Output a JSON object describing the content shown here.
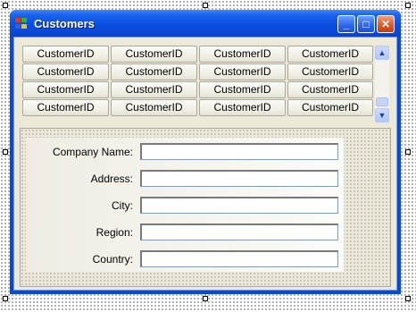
{
  "window": {
    "title": "Customers"
  },
  "title_buttons": {
    "minimize": "_",
    "maximize": "□",
    "close": "✕"
  },
  "grid": {
    "rows": [
      [
        "CustomerID",
        "CustomerID",
        "CustomerID",
        "CustomerID"
      ],
      [
        "CustomerID",
        "CustomerID",
        "CustomerID",
        "CustomerID"
      ],
      [
        "CustomerID",
        "CustomerID",
        "CustomerID",
        "CustomerID"
      ],
      [
        "CustomerID",
        "CustomerID",
        "CustomerID",
        "CustomerID"
      ]
    ]
  },
  "scroll": {
    "up": "▲",
    "down": "▼"
  },
  "form": {
    "company_label": "Company Name:",
    "address_label": "Address:",
    "city_label": "City:",
    "region_label": "Region:",
    "country_label": "Country:",
    "company_value": "",
    "address_value": "",
    "city_value": "",
    "region_value": "",
    "country_value": ""
  },
  "colors": {
    "titlebar": "#0a48d6",
    "client": "#ece9d8",
    "close_button": "#dc5a2a"
  },
  "icons": [
    "app-icon",
    "minimize-icon",
    "maximize-icon",
    "close-icon",
    "scroll-up-icon",
    "scroll-down-icon"
  ]
}
